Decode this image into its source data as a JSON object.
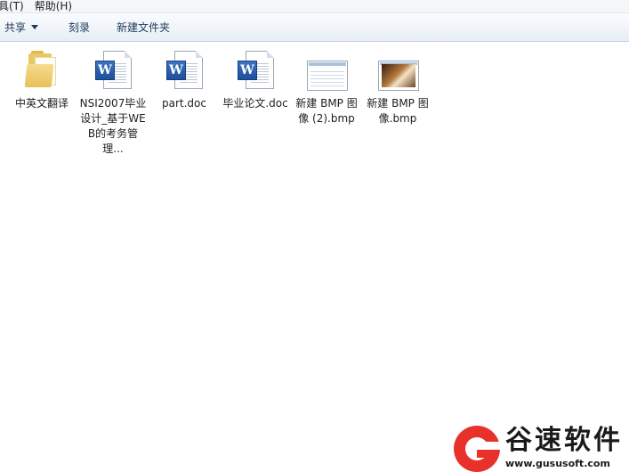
{
  "menubar": {
    "items": [
      "具(T)",
      "帮助(H)"
    ]
  },
  "toolbar": {
    "share_label": "共享",
    "burn_label": "刻录",
    "new_folder_label": "新建文件夹"
  },
  "files": [
    {
      "name": "中英文翻译",
      "type": "folder"
    },
    {
      "name": "NSI2007毕业设计_基于WEB的考务管理...",
      "type": "word-doc"
    },
    {
      "name": "part.doc",
      "type": "word-doc"
    },
    {
      "name": "毕业论文.doc",
      "type": "word-doc"
    },
    {
      "name": "新建 BMP 图像 (2).bmp",
      "type": "bmp-image"
    },
    {
      "name": "新建 BMP 图像.bmp",
      "type": "bmp-image"
    }
  ],
  "watermark": {
    "text": "谷速软件",
    "url": "www.gususoft.com"
  },
  "colors": {
    "toolbar_text": "#1e395b",
    "word_blue": "#2b5fae",
    "watermark_red": "#e8312b"
  }
}
